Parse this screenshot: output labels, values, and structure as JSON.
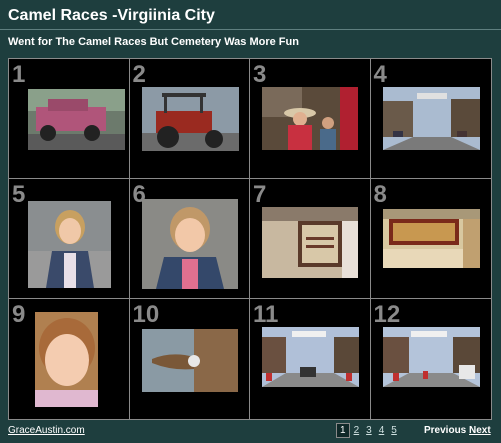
{
  "header": {
    "title": "Camel Races -Virgiinia City",
    "subtitle": "Went for The Camel Races But Cemetery Was More Fun"
  },
  "thumbnails": [
    {
      "number": "1"
    },
    {
      "number": "2"
    },
    {
      "number": "3"
    },
    {
      "number": "4"
    },
    {
      "number": "5"
    },
    {
      "number": "6"
    },
    {
      "number": "7"
    },
    {
      "number": "8"
    },
    {
      "number": "9"
    },
    {
      "number": "10"
    },
    {
      "number": "11"
    },
    {
      "number": "12"
    }
  ],
  "footer": {
    "site_link": "GraceAustin.com",
    "pages": [
      "1",
      "2",
      "3",
      "4",
      "5"
    ],
    "current_page": "1",
    "previous_label": "Previous",
    "next_label": "Next"
  },
  "colors": {
    "background": "#1e3e3e",
    "grid_background": "#000000",
    "grid_lines": "#8a8a8a",
    "number_color": "#8a8a8a"
  }
}
